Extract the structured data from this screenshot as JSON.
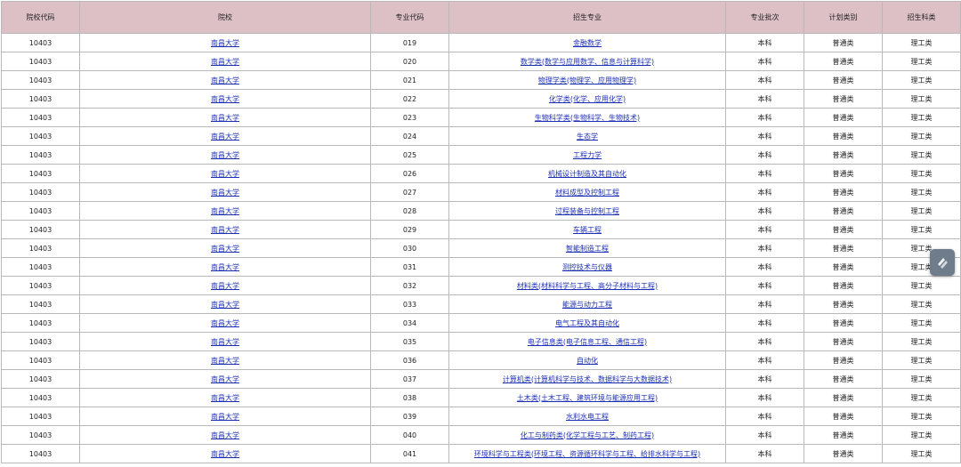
{
  "headers": [
    "院校代码",
    "院校",
    "专业代码",
    "招生专业",
    "专业批次",
    "计划类别",
    "招生科类"
  ],
  "rows": [
    [
      "10403",
      "南昌大学",
      "019",
      "金融数学",
      "本科",
      "普通类",
      "理工类"
    ],
    [
      "10403",
      "南昌大学",
      "020",
      "数学类(数学与应用数学、信息与计算科学)",
      "本科",
      "普通类",
      "理工类"
    ],
    [
      "10403",
      "南昌大学",
      "021",
      "物理学类(物理学、应用物理学)",
      "本科",
      "普通类",
      "理工类"
    ],
    [
      "10403",
      "南昌大学",
      "022",
      "化学类(化学、应用化学)",
      "本科",
      "普通类",
      "理工类"
    ],
    [
      "10403",
      "南昌大学",
      "023",
      "生物科学类(生物科学、生物技术)",
      "本科",
      "普通类",
      "理工类"
    ],
    [
      "10403",
      "南昌大学",
      "024",
      "生态学",
      "本科",
      "普通类",
      "理工类"
    ],
    [
      "10403",
      "南昌大学",
      "025",
      "工程力学",
      "本科",
      "普通类",
      "理工类"
    ],
    [
      "10403",
      "南昌大学",
      "026",
      "机械设计制造及其自动化",
      "本科",
      "普通类",
      "理工类"
    ],
    [
      "10403",
      "南昌大学",
      "027",
      "材料成型及控制工程",
      "本科",
      "普通类",
      "理工类"
    ],
    [
      "10403",
      "南昌大学",
      "028",
      "过程装备与控制工程",
      "本科",
      "普通类",
      "理工类"
    ],
    [
      "10403",
      "南昌大学",
      "029",
      "车辆工程",
      "本科",
      "普通类",
      "理工类"
    ],
    [
      "10403",
      "南昌大学",
      "030",
      "智能制造工程",
      "本科",
      "普通类",
      "理工类"
    ],
    [
      "10403",
      "南昌大学",
      "031",
      "测控技术与仪器",
      "本科",
      "普通类",
      "理工类"
    ],
    [
      "10403",
      "南昌大学",
      "032",
      "材料类(材料科学与工程、高分子材料与工程)",
      "本科",
      "普通类",
      "理工类"
    ],
    [
      "10403",
      "南昌大学",
      "033",
      "能源与动力工程",
      "本科",
      "普通类",
      "理工类"
    ],
    [
      "10403",
      "南昌大学",
      "034",
      "电气工程及其自动化",
      "本科",
      "普通类",
      "理工类"
    ],
    [
      "10403",
      "南昌大学",
      "035",
      "电子信息类(电子信息工程、通信工程)",
      "本科",
      "普通类",
      "理工类"
    ],
    [
      "10403",
      "南昌大学",
      "036",
      "自动化",
      "本科",
      "普通类",
      "理工类"
    ],
    [
      "10403",
      "南昌大学",
      "037",
      "计算机类(计算机科学与技术、数据科学与大数据技术)",
      "本科",
      "普通类",
      "理工类"
    ],
    [
      "10403",
      "南昌大学",
      "038",
      "土木类(土木工程、建筑环境与能源应用工程)",
      "本科",
      "普通类",
      "理工类"
    ],
    [
      "10403",
      "南昌大学",
      "039",
      "水利水电工程",
      "本科",
      "普通类",
      "理工类"
    ],
    [
      "10403",
      "南昌大学",
      "040",
      "化工与制药类(化学工程与工艺、制药工程)",
      "本科",
      "普通类",
      "理工类"
    ],
    [
      "10403",
      "南昌大学",
      "041",
      "环境科学与工程类(环境工程、资源循环科学与工程、给排水科学与工程)",
      "本科",
      "普通类",
      "理工类"
    ]
  ],
  "floating_button": {
    "icon": "floating-tool-icon",
    "color": "#6f7c8c"
  }
}
